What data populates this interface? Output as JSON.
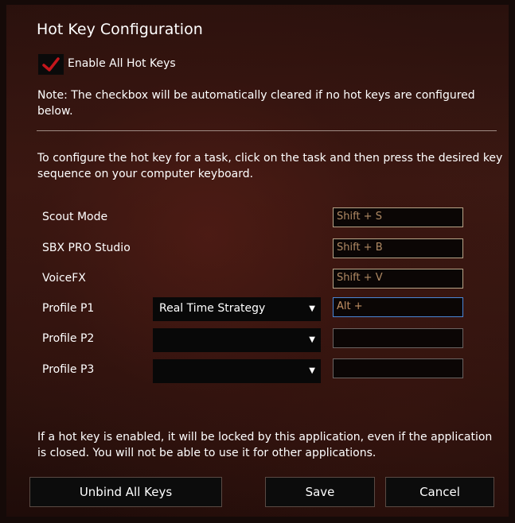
{
  "dialog": {
    "title": "Hot Key Configuration",
    "enable_all": {
      "label": "Enable All Hot Keys",
      "checked": true,
      "check_color": "#c4161c"
    },
    "note": "Note: The checkbox will be automatically cleared if no hot keys are configured below.",
    "instructions": "To configure the hot key for a task, click on the task and then press the desired key sequence on your computer keyboard.",
    "rows": [
      {
        "label": "Scout Mode",
        "hotkey": "Shift + S"
      },
      {
        "label": "SBX PRO Studio",
        "hotkey": "Shift + B"
      },
      {
        "label": "VoiceFX",
        "hotkey": "Shift + V"
      },
      {
        "label": "Profile P1",
        "profile": "Real Time Strategy",
        "hotkey": "Alt + "
      },
      {
        "label": "Profile P2",
        "profile": "",
        "hotkey": ""
      },
      {
        "label": "Profile P3",
        "profile": "",
        "hotkey": ""
      }
    ],
    "footer_text": "If a hot key is enabled, it will be locked by this application, even if the application is closed. You will not be able to use it for other applications.",
    "buttons": {
      "unbind": "Unbind All Keys",
      "save": "Save",
      "cancel": "Cancel"
    },
    "icons": {
      "dropdown": "chevron-down-icon",
      "check": "check-icon"
    },
    "colors": {
      "hotkey_text": "#b08a64",
      "active_border": "#4a86d6"
    }
  }
}
